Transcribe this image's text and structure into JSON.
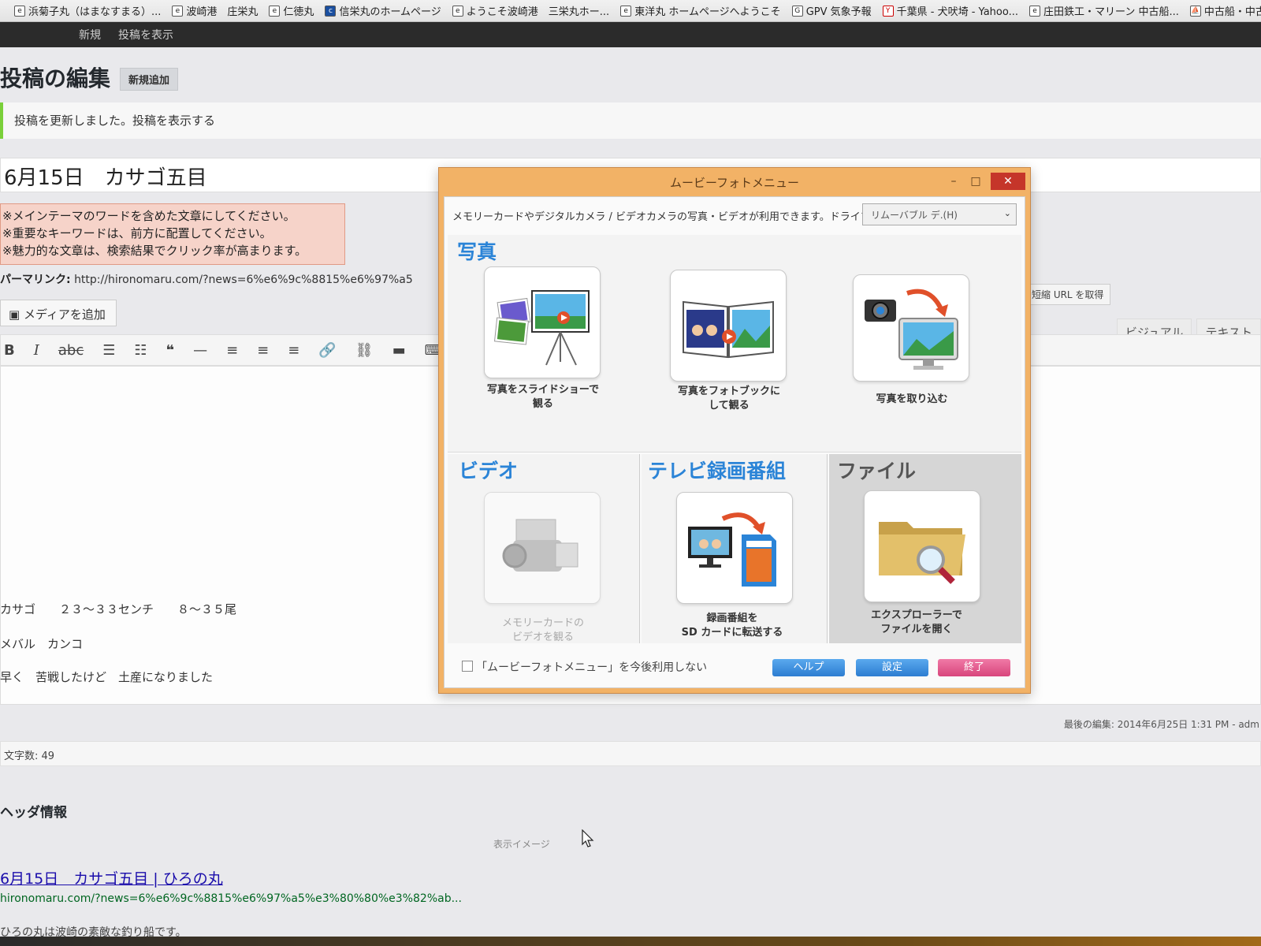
{
  "bookmarks": [
    {
      "icon": "page-icon",
      "label": "浜菊子丸（はまなすまる）..."
    },
    {
      "icon": "page-icon",
      "label": "波崎港　庄栄丸"
    },
    {
      "icon": "page-icon",
      "label": "仁徳丸"
    },
    {
      "icon": "site-icon",
      "label": "信栄丸のホームページ"
    },
    {
      "icon": "page-icon",
      "label": "ようこそ波崎港　三栄丸ホー..."
    },
    {
      "icon": "page-icon",
      "label": "東洋丸 ホームページへようこそ"
    },
    {
      "icon": "gpv-icon",
      "label": "GPV 気象予報"
    },
    {
      "icon": "yahoo-icon",
      "label": "千葉県 - 犬吠埼 - Yahoo..."
    },
    {
      "icon": "page-icon",
      "label": "庄田鉄工・マリーン 中古船..."
    },
    {
      "icon": "boat-icon",
      "label": "中古船・中古ボート"
    }
  ],
  "adminbar": {
    "new": "新規",
    "view_post": "投稿を表示"
  },
  "page": {
    "title": "投稿の編集",
    "add_new": "新規追加",
    "notice": "投稿を更新しました。投稿を表示する",
    "post_title": "6月15日　カサゴ五目",
    "warnings": [
      "※メインテーマのワードを含めた文章にしてください。",
      "※重要なキーワードは、前方に配置してください。",
      "※魅力的な文章は、検索結果でクリック率が高まります。"
    ],
    "permalink_label": "パーマリンク:",
    "permalink_url": "http://hironomaru.com/?news=6%e6%9c%8815%e6%97%a5",
    "add_media": "メディアを追加",
    "shorten_url": "短縮 URL を取得",
    "tab_visual": "ビジュアル",
    "tab_text": "テキスト",
    "content_lines": [
      "カサゴ　　２３～３３センチ　　８～３５尾",
      "メバル　カンコ",
      "早く　苦戦したけど　土産になりました"
    ],
    "last_edited": "最後の編集: 2014年6月25日 1:31 PM - adm",
    "word_count": "文字数: 49",
    "header_info": "ヘッダ情報",
    "preview_label": "表示イメージ",
    "serp_title": "6月15日　カサゴ五目 | ひろの丸",
    "serp_url": "hironomaru.com/?news=6%e6%9c%8815%e6%97%a5%e3%80%80%e3%82%ab...",
    "serp_desc": "ひろの丸は波崎の素敵な釣り船です。"
  },
  "dialog": {
    "title": "ムービーフォトメニュー",
    "description": "メモリーカードやデジタルカメラ / ビデオカメラの写真・ビデオが利用できます。ドライブ：",
    "drive": "リムーバブル デ.(H)",
    "sections": {
      "photo": "写真",
      "video": "ビデオ",
      "tv": "テレビ録画番組",
      "file": "ファイル"
    },
    "tiles": {
      "slideshow": [
        "写真をスライドショーで",
        "観る"
      ],
      "photobook": [
        "写真をフォトブックに",
        "して観る"
      ],
      "import": [
        "写真を取り込む"
      ],
      "memory_video": [
        "メモリーカードの",
        "ビデオを観る"
      ],
      "sd_transfer": [
        "録画番組を",
        "SD カードに転送する"
      ],
      "explorer": [
        "エクスプローラーで",
        "ファイルを開く"
      ]
    },
    "checkbox_label": "「ムービーフォトメニュー」を今後利用しない",
    "buttons": {
      "help": "ヘルプ",
      "settings": "設定",
      "exit": "終了"
    },
    "colors": {
      "frame": "#f2b266",
      "accent_blue": "#2b84d7",
      "close": "#c5352a",
      "exit_button": "#d8457c"
    }
  }
}
